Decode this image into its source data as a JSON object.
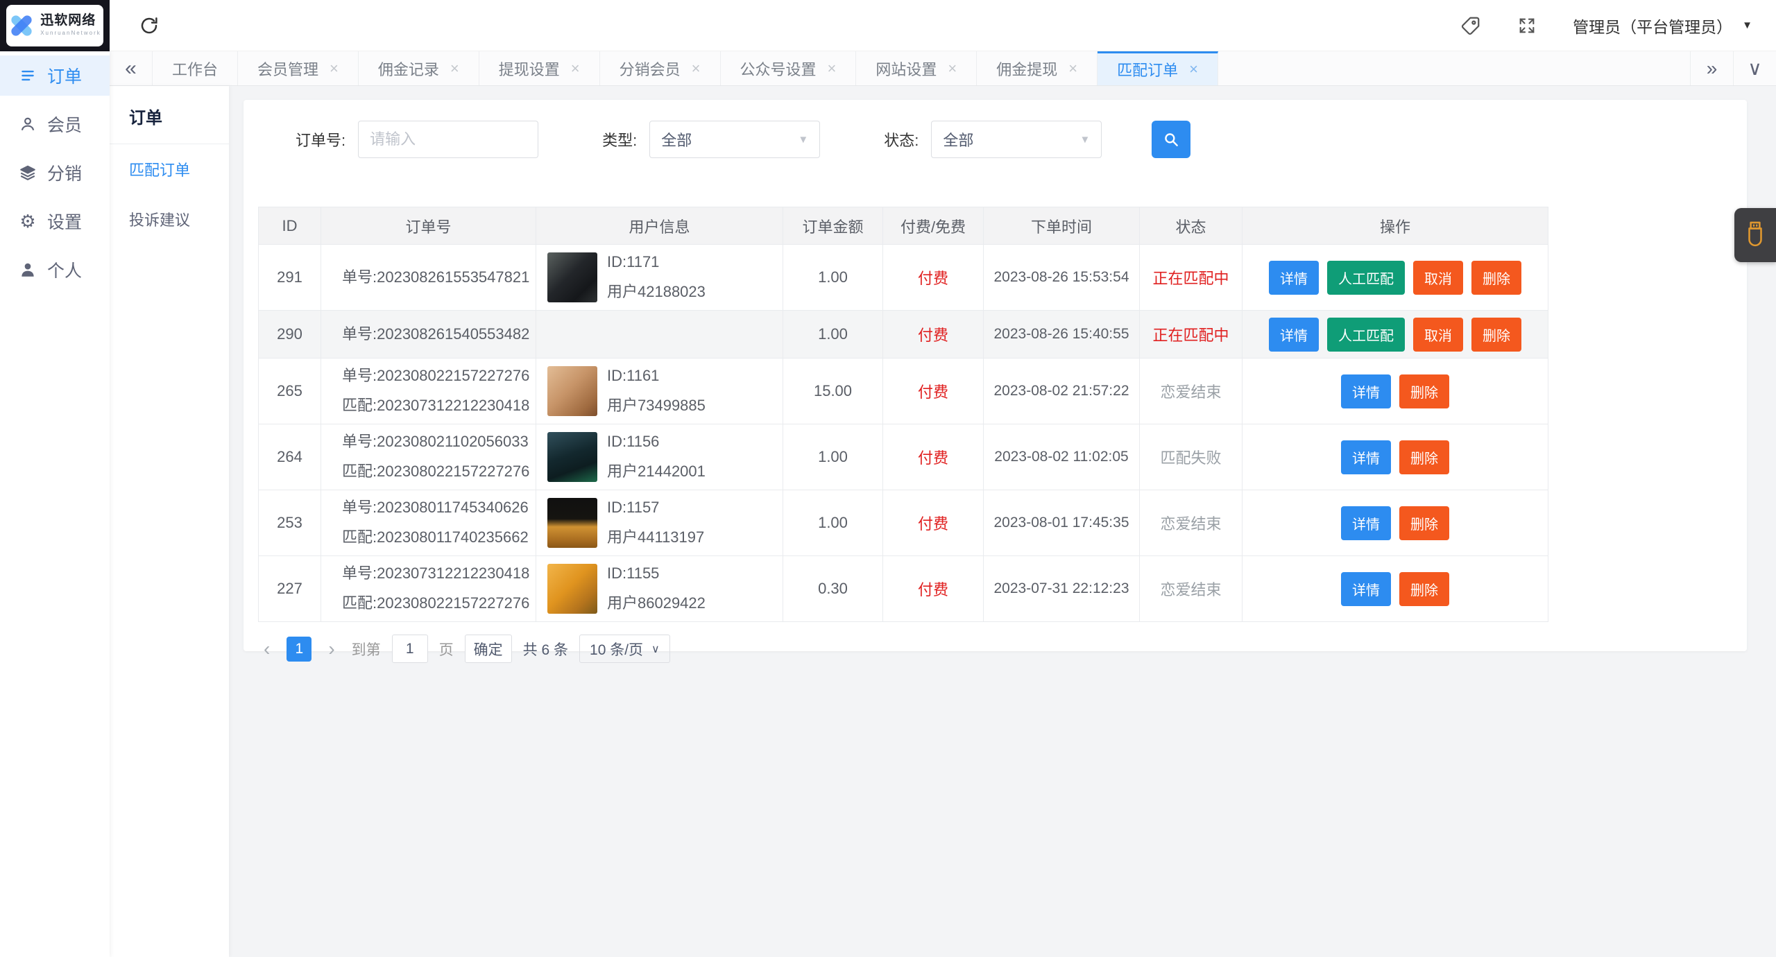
{
  "colors": {
    "accent": "#2d8cf0",
    "danger_red": "#e02020",
    "teal_green": "#0f9d77",
    "orange": "#f4581e",
    "logo_dark": "#15151d",
    "widget_icon_orange": "#e0982f",
    "active_tab_bg": "#e7f2fd",
    "sidebar_active_bg": "#e9f2fd"
  },
  "icons": {
    "close": "×",
    "collapse": "«",
    "more": "»",
    "dropdown": "∨",
    "caret_down": "▼",
    "prev": "‹",
    "next": "›",
    "gear": "⚙"
  },
  "logo": {
    "title": "迅软网络",
    "subtitle": "XunruanNetwork"
  },
  "topbar": {
    "admin_label": "管理员（平台管理员）"
  },
  "sidebar": {
    "items": [
      {
        "label": "订单",
        "active": true
      },
      {
        "label": "会员",
        "active": false
      },
      {
        "label": "分销",
        "active": false
      },
      {
        "label": "设置",
        "active": false
      },
      {
        "label": "个人",
        "active": false
      }
    ]
  },
  "tabs": [
    {
      "label": "工作台",
      "closable": false,
      "active": false
    },
    {
      "label": "会员管理",
      "closable": true,
      "active": false
    },
    {
      "label": "佣金记录",
      "closable": true,
      "active": false
    },
    {
      "label": "提现设置",
      "closable": true,
      "active": false
    },
    {
      "label": "分销会员",
      "closable": true,
      "active": false
    },
    {
      "label": "公众号设置",
      "closable": true,
      "active": false
    },
    {
      "label": "网站设置",
      "closable": true,
      "active": false
    },
    {
      "label": "佣金提现",
      "closable": true,
      "active": false
    },
    {
      "label": "匹配订单",
      "closable": true,
      "active": true
    }
  ],
  "submenu": {
    "title": "订单",
    "items": [
      {
        "label": "匹配订单",
        "active": true
      },
      {
        "label": "投诉建议",
        "active": false
      }
    ]
  },
  "filters": {
    "order_no_label": "订单号:",
    "order_no_placeholder": "请输入",
    "type_label": "类型:",
    "type_value": "全部",
    "status_label": "状态:",
    "status_value": "全部"
  },
  "table": {
    "headers": [
      "ID",
      "订单号",
      "用户信息",
      "订单金额",
      "付费/免费",
      "下单时间",
      "状态",
      "操作"
    ],
    "rows": [
      {
        "id": "291",
        "order_no": "单号:202308261553547821",
        "match_no": "",
        "user_id": "ID:1171",
        "user_name": "用户42188023",
        "avatar": "background:linear-gradient(135deg,#5a615f 0%,#23262a 45%,#15171a 75%,#2e3233 100%)",
        "amount": "1.00",
        "fee_type": "付费",
        "time": "2023-08-26 15:53:54",
        "status": "正在匹配中",
        "status_color": "#e02020",
        "actions": [
          {
            "label": "详情",
            "type": "blue"
          },
          {
            "label": "人工匹配",
            "type": "green"
          },
          {
            "label": "取消",
            "type": "orange"
          },
          {
            "label": "删除",
            "type": "orange"
          }
        ]
      },
      {
        "id": "290",
        "order_no": "单号:202308261540553482",
        "match_no": "",
        "user_id": "",
        "user_name": "",
        "avatar": null,
        "amount": "1.00",
        "fee_type": "付费",
        "time": "2023-08-26 15:40:55",
        "status": "正在匹配中",
        "status_color": "#e02020",
        "actions": [
          {
            "label": "详情",
            "type": "blue"
          },
          {
            "label": "人工匹配",
            "type": "green"
          },
          {
            "label": "取消",
            "type": "orange"
          },
          {
            "label": "删除",
            "type": "orange"
          }
        ]
      },
      {
        "id": "265",
        "order_no": "单号:202308022157227276",
        "match_no": "匹配:202307312212230418",
        "user_id": "ID:1161",
        "user_name": "用户73499885",
        "avatar": "background:linear-gradient(135deg,#e3bd96 0%,#c79468 45%,#a06b40 80%,#7d4e2c 100%)",
        "amount": "15.00",
        "fee_type": "付费",
        "time": "2023-08-02 21:57:22",
        "status": "恋爱结束",
        "status_color": "#9aa0a6",
        "actions": [
          {
            "label": "详情",
            "type": "blue"
          },
          {
            "label": "删除",
            "type": "orange"
          }
        ]
      },
      {
        "id": "264",
        "order_no": "单号:202308021102056033",
        "match_no": "匹配:202308022157227276",
        "user_id": "ID:1156",
        "user_name": "用户21442001",
        "avatar": "background:linear-gradient(160deg,#31505c 0%,#13282e 45%,#0d1d20 70%,#1d6a4a 100%)",
        "amount": "1.00",
        "fee_type": "付费",
        "time": "2023-08-02 11:02:05",
        "status": "匹配失败",
        "status_color": "#9aa0a6",
        "actions": [
          {
            "label": "详情",
            "type": "blue"
          },
          {
            "label": "删除",
            "type": "orange"
          }
        ]
      },
      {
        "id": "253",
        "order_no": "单号:202308011745340626",
        "match_no": "匹配:202308011740235662",
        "user_id": "ID:1157",
        "user_name": "用户44113197",
        "avatar": "background:linear-gradient(180deg,#101010 0%,#161410 42%,#cf9232 58%,#a86c20 85%,#8a5717 100%)",
        "amount": "1.00",
        "fee_type": "付费",
        "time": "2023-08-01 17:45:35",
        "status": "恋爱结束",
        "status_color": "#9aa0a6",
        "actions": [
          {
            "label": "详情",
            "type": "blue"
          },
          {
            "label": "删除",
            "type": "orange"
          }
        ]
      },
      {
        "id": "227",
        "order_no": "单号:202307312212230418",
        "match_no": "匹配:202308022157227276",
        "user_id": "ID:1155",
        "user_name": "用户86029422",
        "avatar": "background:linear-gradient(135deg,#f2b54a 0%,#e0941f 45%,#b5741d 75%,#7d5a1a 100%)",
        "amount": "0.30",
        "fee_type": "付费",
        "time": "2023-07-31 22:12:23",
        "status": "恋爱结束",
        "status_color": "#9aa0a6",
        "actions": [
          {
            "label": "详情",
            "type": "blue"
          },
          {
            "label": "删除",
            "type": "orange"
          }
        ]
      }
    ]
  },
  "pagination": {
    "current_page": "1",
    "goto_label": "到第",
    "page_input": "1",
    "page_unit": "页",
    "confirm_label": "确定",
    "total_label": "共 6 条",
    "per_page_label": "10 条/页"
  }
}
